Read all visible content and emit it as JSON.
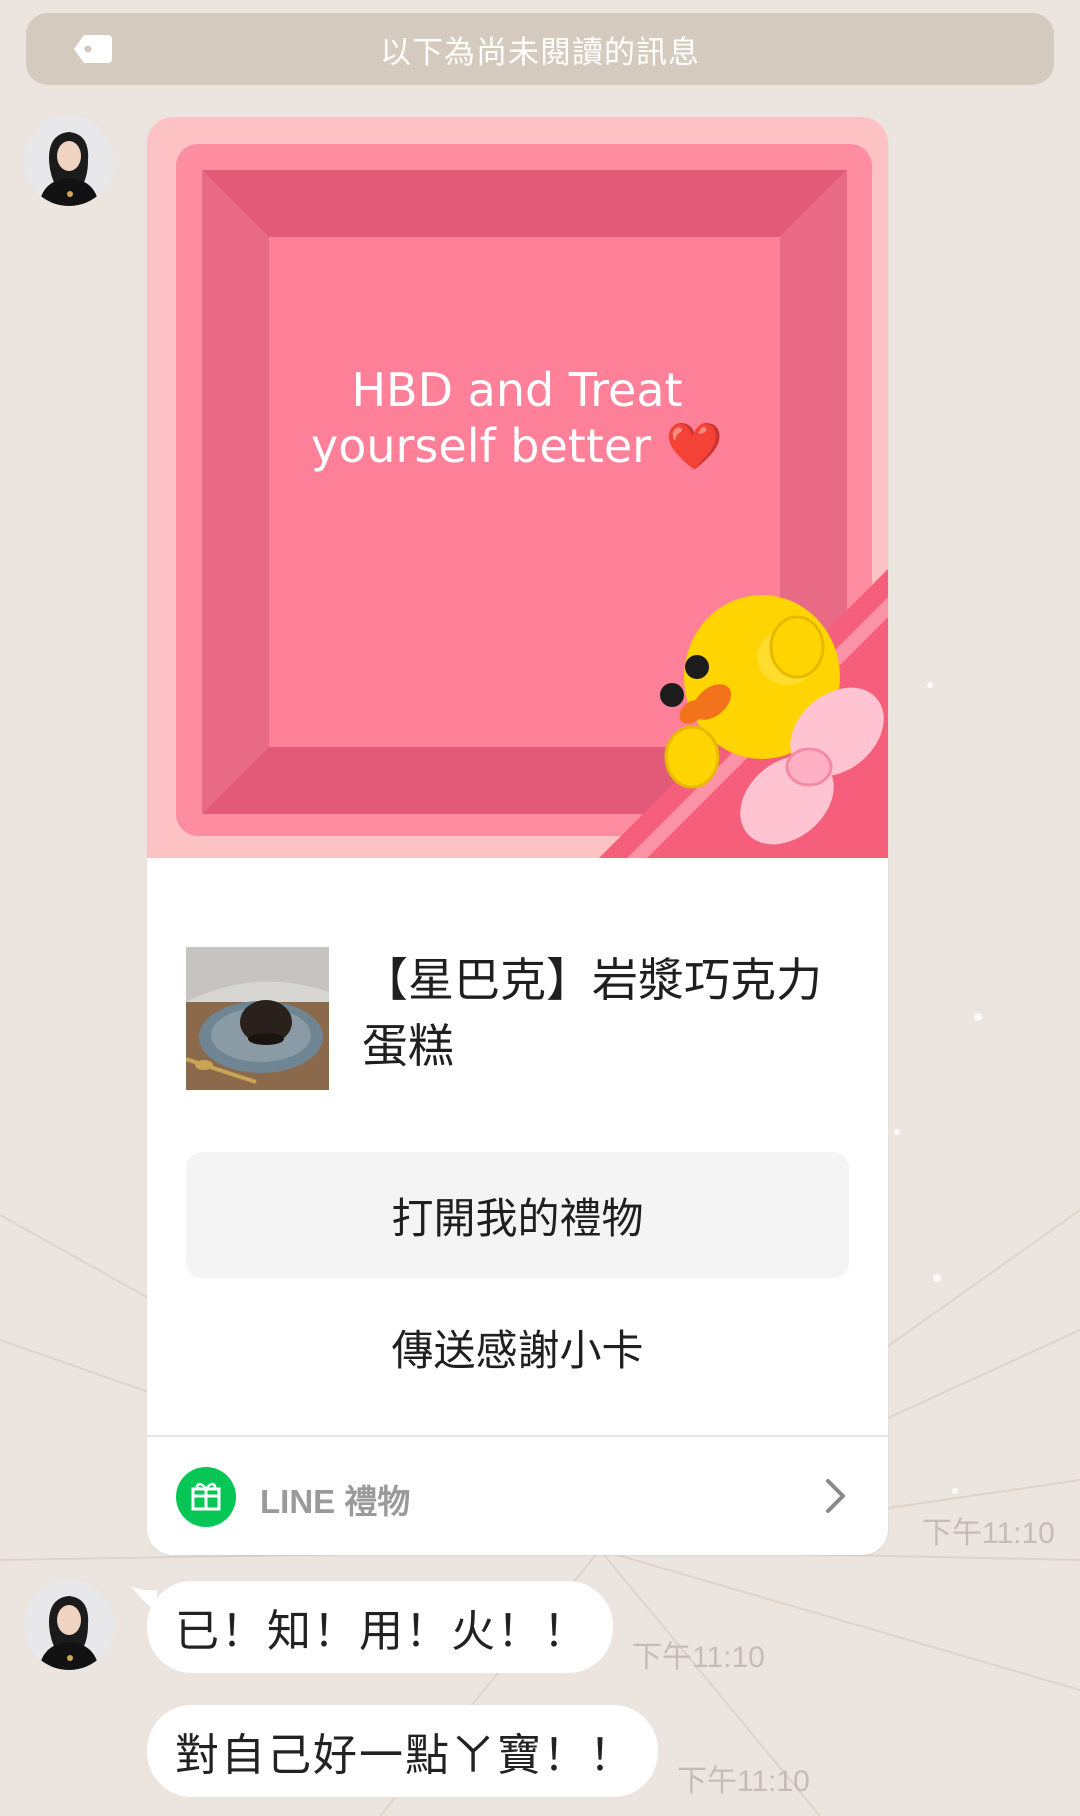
{
  "unread_banner": {
    "icon": "tag-icon",
    "text": "以下為尚未閱讀的訊息"
  },
  "messages": [
    {
      "type": "gift",
      "avatar": "avatar",
      "gift_message": "HBD and Treat yourself better ❤️",
      "product_name": "【星巴克】岩漿巧克力蛋糕",
      "open_gift_label": "打開我的禮物",
      "thanks_label": "傳送感謝小卡",
      "footer_label": "LINE 禮物",
      "footer_icon": "gift-icon",
      "time": "下午11:10"
    },
    {
      "type": "text",
      "avatar": "avatar",
      "text": "已！知！用！火！！",
      "time": "下午11:10"
    },
    {
      "type": "text",
      "text": "對自己好一點ㄚ寶！！",
      "time": "下午11:10"
    }
  ],
  "colors": {
    "background": "#ece5df",
    "banner": "#d4cabe",
    "line_green": "#06c755",
    "gift_pink": "#ff8da1"
  }
}
